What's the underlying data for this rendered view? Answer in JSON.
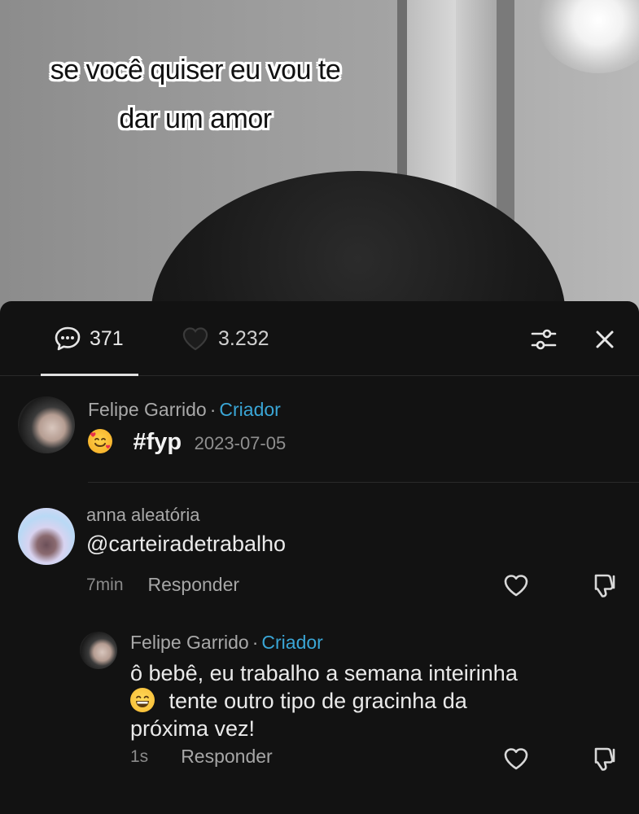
{
  "video": {
    "caption_line1": "se você quiser eu vou te",
    "caption_line2": "dar um amor"
  },
  "sheet": {
    "tabs": {
      "comments_count": "371",
      "likes_count": "3.232"
    },
    "icons": {
      "comments": "comment-bubble-icon",
      "likes": "heart-outline-icon",
      "filter": "sliders-icon",
      "close": "close-icon"
    },
    "caption_post": {
      "author": "Felipe Garrido",
      "separator": "·",
      "badge": "Criador",
      "emoji": "smiling-face-with-hearts",
      "hashtag": "#fyp",
      "date": "2023-07-05"
    },
    "comments": [
      {
        "author": "anna aleatória",
        "text": "@carteiradetrabalho",
        "time": "7min",
        "reply_label": "Responder"
      }
    ],
    "replies": [
      {
        "author": "Felipe Garrido",
        "separator": "·",
        "badge": "Criador",
        "text_line1": "ô bebê, eu trabalho a semana inteirinha",
        "text_line2": "tente outro tipo de gracinha da",
        "text_line3": "próxima vez!",
        "emoji": "grinning-face",
        "time": "1s",
        "reply_label": "Responder"
      }
    ]
  },
  "colors": {
    "background": "#121212",
    "creator_badge": "#3aa6d6",
    "text_primary": "#eaeaea",
    "text_secondary": "#a9a9a9"
  }
}
